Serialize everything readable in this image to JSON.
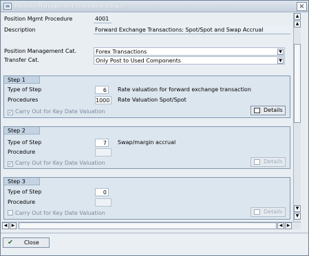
{
  "window": {
    "title": "Position Management Procedure Details",
    "close_glyph": "×"
  },
  "header_fields": {
    "procedure_label": "Position Mgmt Procedure",
    "procedure_value": "4001",
    "description_label": "Description",
    "description_value": "Forward Exchange Transactions: Spot/Spot and Swap Accrual",
    "cat_label": "Position Management Cat.",
    "cat_value": "Forex Transactions",
    "transfer_label": "Transfer Cat.",
    "transfer_value": "Only Post to Used Components"
  },
  "steps": [
    {
      "title": "Step 1",
      "type_label": "Type of Step",
      "type_value": "6",
      "type_desc": "Rate valuation for forward exchange transaction",
      "proc_label": "Procedures",
      "proc_value": "1000",
      "proc_desc": "Rate Valuation Spot/Spot",
      "chk_label": "Carry Out for Key Date Valuation",
      "checked": true,
      "details_label": "Details",
      "details_enabled": true
    },
    {
      "title": "Step 2",
      "type_label": "Type of Step",
      "type_value": "7",
      "type_desc": "Swap/margin accrual",
      "proc_label": "Procedure",
      "proc_value": "",
      "proc_desc": "",
      "chk_label": "Carry Out for Key Date Valuation",
      "checked": true,
      "details_label": "Details",
      "details_enabled": false
    },
    {
      "title": "Step 3",
      "type_label": "Type of Step",
      "type_value": "0",
      "type_desc": "",
      "proc_label": "Procedure",
      "proc_value": "",
      "proc_desc": "",
      "chk_label": "Carry Out for Key Date Valuation",
      "checked": false,
      "details_label": "Details",
      "details_enabled": false
    }
  ],
  "footer": {
    "close_label": "Close",
    "close_icon": "checkmark-icon"
  },
  "icons": {
    "check": "✔",
    "dropdown": "▼",
    "scroll_up": "▲",
    "scroll_down": "▼",
    "scroll_left": "◀",
    "scroll_right": "▶"
  }
}
